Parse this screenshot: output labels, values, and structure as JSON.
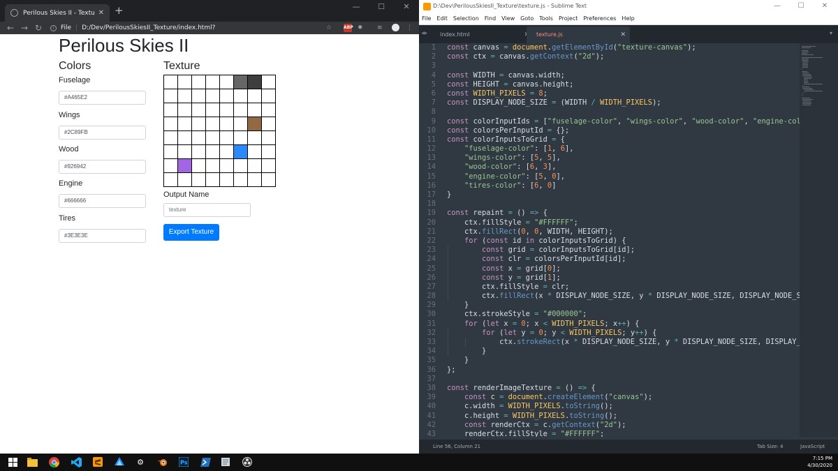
{
  "chrome": {
    "tab_title": "Perilous Skies II - Texture",
    "close_tab": "✕",
    "new_tab": "+",
    "url_scheme": "File",
    "url": "D:/Dev/PerilousSkiesII_Texture/index.html?",
    "ext_abp": "ABP"
  },
  "window_controls": {
    "minimize": "—",
    "maximize": "☐",
    "close": "✕"
  },
  "page": {
    "title": "Perilous Skies II",
    "colors_heading": "Colors",
    "texture_heading": "Texture",
    "color_fields": [
      {
        "label": "Fuselage",
        "value": "#A465E2"
      },
      {
        "label": "Wings",
        "value": "#2C89FB"
      },
      {
        "label": "Wood",
        "value": "#926942"
      },
      {
        "label": "Engine",
        "value": "#666666"
      },
      {
        "label": "Tires",
        "value": "#3E3E3E"
      }
    ],
    "output_label": "Output Name",
    "output_placeholder": "texture",
    "export_button": "Export Texture"
  },
  "texture_grid": {
    "size": 8,
    "background": "#FFFFFF",
    "stroke": "#000000",
    "cells": [
      {
        "x": 1,
        "y": 6,
        "color": "#A465E2"
      },
      {
        "x": 5,
        "y": 5,
        "color": "#2C89FB"
      },
      {
        "x": 6,
        "y": 3,
        "color": "#926942"
      },
      {
        "x": 5,
        "y": 0,
        "color": "#666666"
      },
      {
        "x": 6,
        "y": 0,
        "color": "#3E3E3E"
      }
    ]
  },
  "sublime": {
    "title": "D:\\Dev\\PerilousSkiesII_Texture\\texture.js - Sublime Text",
    "menu": [
      "File",
      "Edit",
      "Selection",
      "Find",
      "View",
      "Goto",
      "Tools",
      "Project",
      "Preferences",
      "Help"
    ],
    "tabs": [
      {
        "label": "index.html",
        "active": false
      },
      {
        "label": "texture.js",
        "active": true
      }
    ],
    "tab_close": "✕",
    "status_left": "Line 56, Column 21",
    "status_tabsize": "Tab Size: 4",
    "status_lang": "JavaScript",
    "code": [
      {
        "n": 1,
        "t": "const canvas = document.getElementById(\"texture-canvas\");"
      },
      {
        "n": 2,
        "t": "const ctx = canvas.getContext(\"2d\");"
      },
      {
        "n": 3,
        "t": ""
      },
      {
        "n": 4,
        "t": "const WIDTH = canvas.width;"
      },
      {
        "n": 5,
        "t": "const HEIGHT = canvas.height;"
      },
      {
        "n": 6,
        "t": "const WIDTH_PIXELS = 8;"
      },
      {
        "n": 7,
        "t": "const DISPLAY_NODE_SIZE = (WIDTH / WIDTH_PIXELS);"
      },
      {
        "n": 8,
        "t": ""
      },
      {
        "n": 9,
        "t": "const colorInputIds = [\"fuselage-color\", \"wings-color\", \"wood-color\", \"engine-color\","
      },
      {
        "n": 10,
        "t": "const colorsPerInputId = {};"
      },
      {
        "n": 11,
        "t": "const colorInputsToGrid = {"
      },
      {
        "n": 12,
        "t": "    \"fuselage-color\": [1, 6],"
      },
      {
        "n": 13,
        "t": "    \"wings-color\": [5, 5],"
      },
      {
        "n": 14,
        "t": "    \"wood-color\": [6, 3],"
      },
      {
        "n": 15,
        "t": "    \"engine-color\": [5, 0],"
      },
      {
        "n": 16,
        "t": "    \"tires-color\": [6, 0]"
      },
      {
        "n": 17,
        "t": "}"
      },
      {
        "n": 18,
        "t": ""
      },
      {
        "n": 19,
        "t": "const repaint = () => {"
      },
      {
        "n": 20,
        "t": "    ctx.fillStyle = \"#FFFFFF\";"
      },
      {
        "n": 21,
        "t": "    ctx.fillRect(0, 0, WIDTH, HEIGHT);"
      },
      {
        "n": 22,
        "t": "    for (const id in colorInputsToGrid) {"
      },
      {
        "n": 23,
        "t": "        const grid = colorInputsToGrid[id];"
      },
      {
        "n": 24,
        "t": "        const clr = colorsPerInputId[id];"
      },
      {
        "n": 25,
        "t": "        const x = grid[0];"
      },
      {
        "n": 26,
        "t": "        const y = grid[1];"
      },
      {
        "n": 27,
        "t": "        ctx.fillStyle = clr;"
      },
      {
        "n": 28,
        "t": "        ctx.fillRect(x * DISPLAY_NODE_SIZE, y * DISPLAY_NODE_SIZE, DISPLAY_NODE_SIZE,"
      },
      {
        "n": 29,
        "t": "    }"
      },
      {
        "n": 30,
        "t": "    ctx.strokeStyle = \"#000000\";"
      },
      {
        "n": 31,
        "t": "    for (let x = 0; x < WIDTH_PIXELS; x++) {"
      },
      {
        "n": 32,
        "t": "        for (let y = 0; y < WIDTH_PIXELS; y++) {"
      },
      {
        "n": 33,
        "t": "            ctx.strokeRect(x * DISPLAY_NODE_SIZE, y * DISPLAY_NODE_SIZE, DISPLAY_NODE"
      },
      {
        "n": 34,
        "t": "        }"
      },
      {
        "n": 35,
        "t": "    }"
      },
      {
        "n": 36,
        "t": "};"
      },
      {
        "n": 37,
        "t": ""
      },
      {
        "n": 38,
        "t": "const renderImageTexture = () => {"
      },
      {
        "n": 39,
        "t": "    const c = document.createElement(\"canvas\");"
      },
      {
        "n": 40,
        "t": "    c.width = WIDTH_PIXELS.toString();"
      },
      {
        "n": 41,
        "t": "    c.height = WIDTH_PIXELS.toString();"
      },
      {
        "n": 42,
        "t": "    const renderCtx = c.getContext(\"2d\");"
      },
      {
        "n": 43,
        "t": "    renderCtx.fillStyle = \"#FFFFFF\";"
      }
    ]
  },
  "taskbar": {
    "time": "7:15 PM",
    "date": "4/30/2020",
    "icons": [
      "windows-start",
      "file-explorer",
      "chrome",
      "vscode",
      "sublime-text",
      "azure",
      "settings",
      "blender",
      "photoshop",
      "powershell",
      "notepad",
      "obs"
    ]
  }
}
